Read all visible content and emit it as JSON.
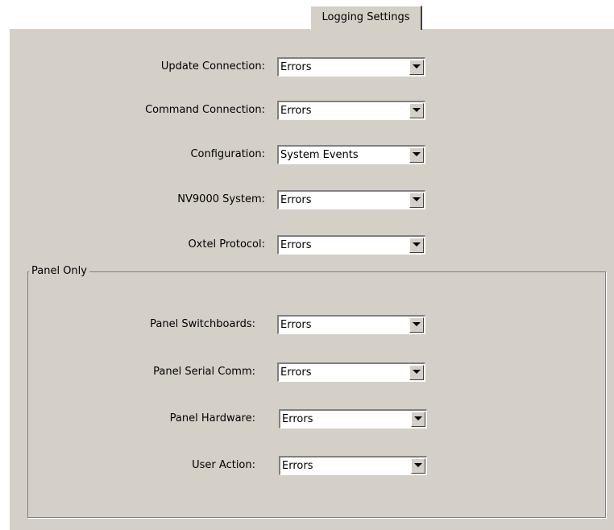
{
  "tab": {
    "label": "Logging Settings"
  },
  "settings": [
    {
      "label": "Update Connection:",
      "value": "Errors"
    },
    {
      "label": "Command Connection:",
      "value": "Errors"
    },
    {
      "label": "Configuration:",
      "value": "System Events"
    },
    {
      "label": "NV9000 System:",
      "value": "Errors"
    },
    {
      "label": "Oxtel Protocol:",
      "value": "Errors"
    }
  ],
  "panel_only": {
    "title": "Panel Only",
    "settings": [
      {
        "label": "Panel Switchboards:",
        "value": "Errors"
      },
      {
        "label": "Panel Serial Comm:",
        "value": "Errors"
      },
      {
        "label": "Panel Hardware:",
        "value": "Errors"
      },
      {
        "label": "User Action:",
        "value": "Errors"
      }
    ]
  },
  "icons": {
    "dropdown": "dropdown-arrow-icon"
  }
}
